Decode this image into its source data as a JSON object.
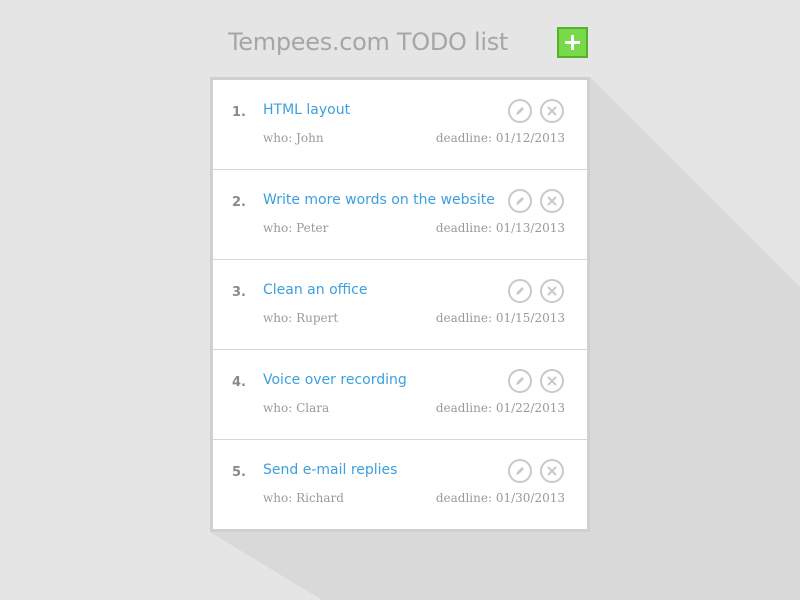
{
  "header": {
    "title": "Tempees.com TODO list",
    "add_icon": "plus-icon"
  },
  "colors": {
    "background": "#e5e5e5",
    "accent_green": "#78d94a",
    "link_blue": "#3b9fe0",
    "muted_text": "#9a9a9a"
  },
  "todos": [
    {
      "number": "1.",
      "task": "HTML layout",
      "who": "who: John",
      "deadline": "deadline: 01/12/2013",
      "edit_icon": "pencil-icon",
      "delete_icon": "close-icon"
    },
    {
      "number": "2.",
      "task": "Write more words on the website",
      "who": "who: Peter",
      "deadline": "deadline: 01/13/2013",
      "edit_icon": "pencil-icon",
      "delete_icon": "close-icon"
    },
    {
      "number": "3.",
      "task": "Clean an office",
      "who": "who: Rupert",
      "deadline": "deadline: 01/15/2013",
      "edit_icon": "pencil-icon",
      "delete_icon": "close-icon"
    },
    {
      "number": "4.",
      "task": "Voice over recording",
      "who": "who: Clara",
      "deadline": "deadline: 01/22/2013",
      "edit_icon": "pencil-icon",
      "delete_icon": "close-icon"
    },
    {
      "number": "5.",
      "task": "Send e-mail replies",
      "who": "who: Richard",
      "deadline": "deadline: 01/30/2013",
      "edit_icon": "pencil-icon",
      "delete_icon": "close-icon"
    }
  ]
}
